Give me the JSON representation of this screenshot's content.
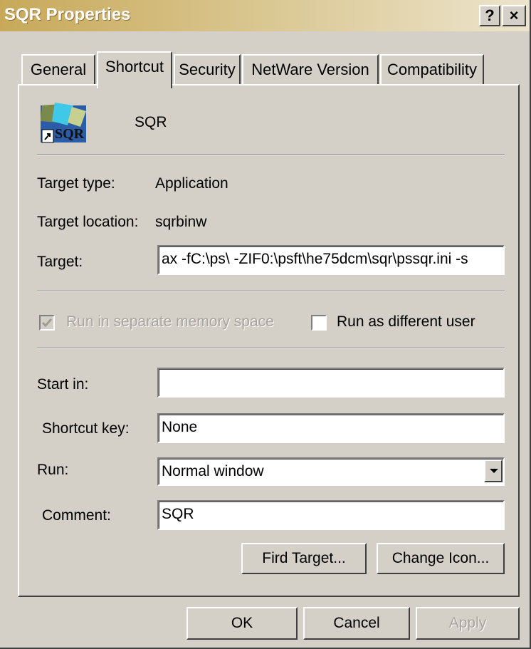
{
  "window": {
    "title": "SQR Properties",
    "help_label": "?",
    "close_label": "×"
  },
  "tabs": [
    {
      "label": "General"
    },
    {
      "label": "Shortcut"
    },
    {
      "label": "Security"
    },
    {
      "label": "NetWare Version"
    },
    {
      "label": "Compatibility"
    }
  ],
  "shortcut": {
    "name": "SQR",
    "icon_text": "SQR",
    "target_type_label": "Target type:",
    "target_type_value": "Application",
    "target_location_label": "Target location:",
    "target_location_value": "sqrbinw",
    "target_label": "Target:",
    "target_value": "ax -fC:\\ps\\ -ZIF0:\\psft\\he75dcm\\sqr\\pssqr.ini -s",
    "run_separate_label": "Run in separate memory space",
    "run_different_user_label": "Run as different user",
    "start_in_label": "Start in:",
    "start_in_value": "",
    "shortcut_key_label": "Shortcut key:",
    "shortcut_key_value": "None",
    "run_label": "Run:",
    "run_value": "Normal window",
    "comment_label": "Comment:",
    "comment_value": "SQR",
    "find_target_label": "Fird Target...",
    "change_icon_label": "Change Icon..."
  },
  "buttons": {
    "ok": "OK",
    "cancel": "Cancel",
    "apply": "Apply"
  }
}
